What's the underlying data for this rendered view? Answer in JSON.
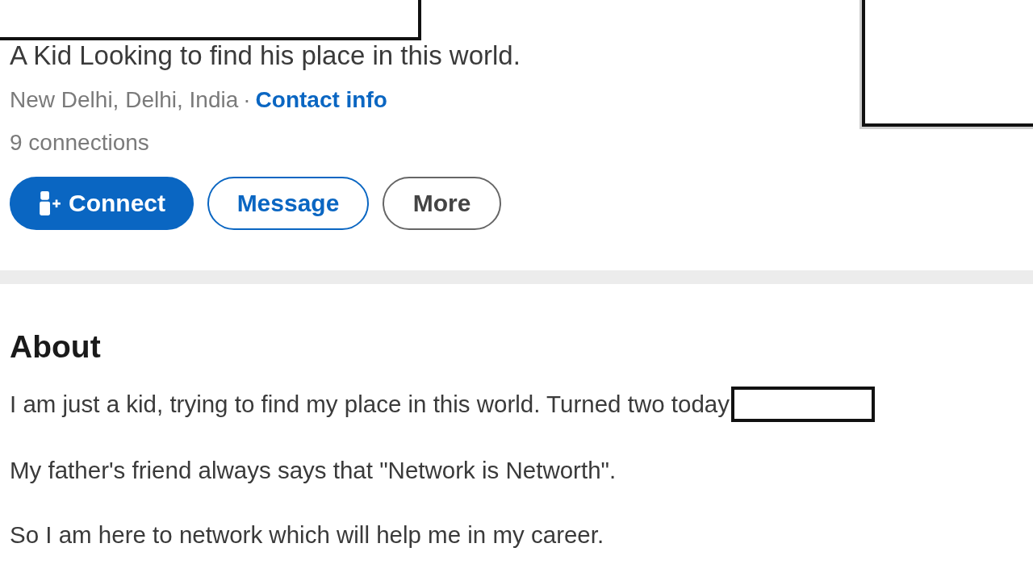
{
  "profile": {
    "headline": "A Kid Looking to find his place in this world.",
    "location": "New Delhi, Delhi, India",
    "separator": "·",
    "contact_link": "Contact info",
    "connections": "9 connections",
    "actions": [
      {
        "label": "Connect",
        "kind": "primary"
      },
      {
        "label": "Message",
        "kind": "outline-blue"
      },
      {
        "label": "More",
        "kind": "outline-gray"
      }
    ]
  },
  "about": {
    "title": "About",
    "paragraphs": [
      {
        "text": "I am just a kid, trying to find my place in this world. Turned two today",
        "redacted_after": true
      },
      {
        "text": "My father's friend always says that \"Network is Networth\".",
        "redacted_after": false
      },
      {
        "text": "So I am here to network which will help me in my career.",
        "redacted_after": false
      }
    ]
  }
}
